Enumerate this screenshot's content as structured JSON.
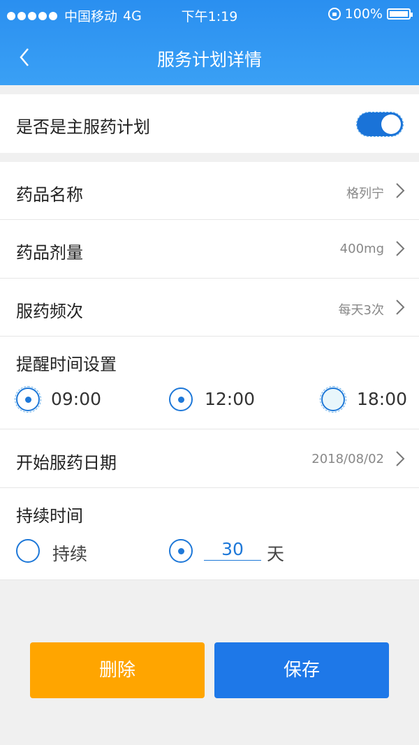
{
  "status_bar": {
    "carrier": "中国移动",
    "network": "4G",
    "time": "下午1:19",
    "battery": "100%"
  },
  "nav": {
    "title": "服务计划详情"
  },
  "main_plan": {
    "label": "是否是主服药计划",
    "enabled": true
  },
  "drug_name": {
    "label": "药品名称",
    "value": "格列宁"
  },
  "dosage": {
    "label": "药品剂量",
    "value": "400mg"
  },
  "frequency": {
    "label": "服药频次",
    "value": "每天3次"
  },
  "reminder": {
    "label": "提醒时间设置",
    "times": [
      "09:00",
      "12:00",
      "18:00"
    ]
  },
  "start_date": {
    "label": "开始服药日期",
    "value": "2018/08/02"
  },
  "duration": {
    "label": "持续时间",
    "option_continuous": "持续",
    "days_value": "30",
    "days_unit": "天"
  },
  "buttons": {
    "delete": "删除",
    "save": "保存"
  },
  "colors": {
    "header": "#2a8ff0",
    "accent": "#1e78d8",
    "delete_button": "#ffa500",
    "save_button": "#1e78e8"
  }
}
